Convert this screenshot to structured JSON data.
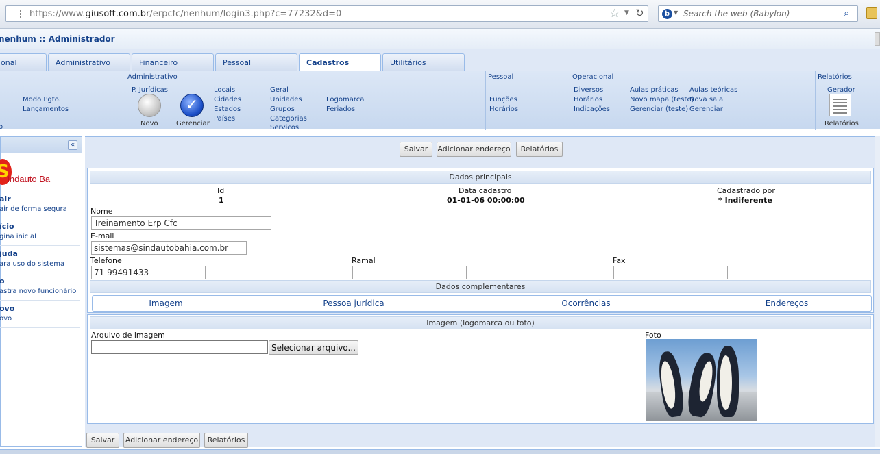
{
  "browser": {
    "url_prefix": "https://www.",
    "url_domain": "giusoft.com.br",
    "url_path": "/erpcfc/nenhum/login3.php?c=77232&d=0",
    "search_placeholder": "Search the web (Babylon)"
  },
  "app": {
    "title": "nenhum :: Administrador"
  },
  "tabs": [
    {
      "label": "onal",
      "active": false
    },
    {
      "label": "Administrativo",
      "active": false
    },
    {
      "label": "Financeiro",
      "active": false
    },
    {
      "label": "Pessoal",
      "active": false
    },
    {
      "label": "Cadastros",
      "active": true
    },
    {
      "label": "Utilitários",
      "active": false
    }
  ],
  "ribbon": {
    "first": {
      "links": [
        "Modo Pgto.",
        "Lançamentos"
      ],
      "partial": "o"
    },
    "administrativo": {
      "title": "Administrativo",
      "pj_label": "P. Jurídicas",
      "novo": "Novo",
      "gerenciar": "Gerenciar",
      "locais": [
        "Locais",
        "Cidades",
        "Estados",
        "Países"
      ],
      "geral": [
        "Geral",
        "Unidades",
        "Grupos",
        "Categorias",
        "Serviços"
      ],
      "misc": [
        "Logomarca",
        "Feriados"
      ]
    },
    "pessoal": {
      "title": "Pessoal",
      "links": [
        "Funções",
        "Horários"
      ]
    },
    "operacional": {
      "title": "Operacional",
      "col1": [
        "Diversos",
        "Horários",
        "Indicações"
      ],
      "col2": [
        "Aulas práticas",
        "Novo mapa (teste)",
        "Gerenciar (teste)"
      ],
      "col3": [
        "Aulas teóricas",
        "Nova sala",
        "Gerenciar"
      ]
    },
    "relatorios": {
      "title": "Relatórios",
      "gerador": "Gerador",
      "label": "Relatórios"
    }
  },
  "sidebar": {
    "logo_letter": "S",
    "logo_text": "indauto Ba",
    "items": [
      {
        "title": "air",
        "desc": "air de forma segura"
      },
      {
        "title": "ício",
        "desc": "gina inicial"
      },
      {
        "title": "juda",
        "desc": "ara uso do sistema"
      },
      {
        "title": "o",
        "desc": "astra novo funcionário"
      },
      {
        "title": "ovo",
        "desc": "ovo"
      }
    ]
  },
  "toolbar": {
    "save": "Salvar",
    "add_address": "Adicionar endereço",
    "reports": "Relatórios"
  },
  "dados_principais": {
    "header": "Dados principais",
    "id_label": "Id",
    "id_value": "1",
    "data_label": "Data cadastro",
    "data_value": "01-01-06 00:00:00",
    "por_label": "Cadastrado por",
    "por_value": "* Indiferente",
    "nome_label": "Nome",
    "nome_value": "Treinamento Erp Cfc",
    "email_label": "E-mail",
    "email_value": "sistemas@sindautobahia.com.br",
    "telefone_label": "Telefone",
    "telefone_value": "71 99491433",
    "ramal_label": "Ramal",
    "ramal_value": "",
    "fax_label": "Fax",
    "fax_value": ""
  },
  "complementares": {
    "header": "Dados complementares",
    "tabs": [
      "Imagem",
      "Pessoa jurídica",
      "Ocorrências",
      "Endereços"
    ]
  },
  "imagem": {
    "header": "Imagem (logomarca ou foto)",
    "arquivo_label": "Arquivo de imagem",
    "select_button": "Selecionar arquivo...",
    "foto_label": "Foto"
  }
}
